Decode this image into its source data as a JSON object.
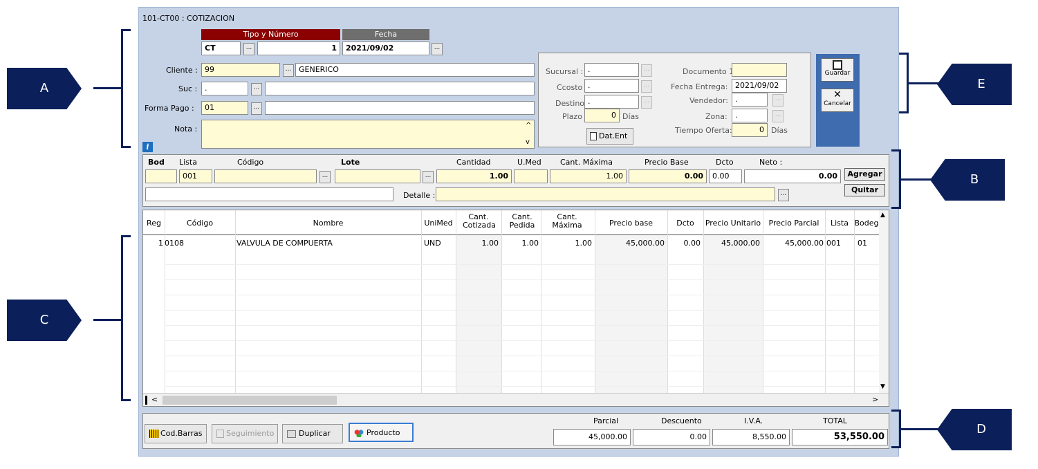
{
  "window": {
    "title": "101-CT00 : COTIZACION"
  },
  "header": {
    "tipo_label": "Tipo y Número",
    "fecha_label": "Fecha",
    "tipo": "CT",
    "numero": "1",
    "fecha": "2021/09/02"
  },
  "client": {
    "cliente_label": "Cliente :",
    "cliente_code": "99",
    "cliente_name": "GENERICO",
    "suc_label": "Suc :",
    "suc_value": ".",
    "forma_label": "Forma Pago :",
    "forma_value": "01",
    "nota_label": "Nota :"
  },
  "extra": {
    "sucursal_label": "Sucursal :",
    "sucursal": ".",
    "ccosto_label": "Ccosto :",
    "ccosto": ".",
    "destino_label": "Destino :",
    "destino": ".",
    "plazo_label": "Plazo :",
    "plazo": "0",
    "dias": "Días",
    "doc1_label": "Documento 1:",
    "doc1": "",
    "fecha_ent_label": "Fecha Entrega:",
    "fecha_ent": "2021/09/02",
    "vendedor_label": "Vendedor:",
    "vendedor": ".",
    "zona_label": "Zona:",
    "zona": ".",
    "tiempo_label": "Tiempo Oferta:",
    "tiempo": "0",
    "dias2": "Días",
    "datent": "Dat.Ent"
  },
  "actions": {
    "guardar": "Guardar",
    "cancelar": "Cancelar"
  },
  "entry": {
    "bod": "Bod",
    "lista": "Lista",
    "codigo": "Código",
    "lote": "Lote",
    "cantidad": "Cantidad",
    "umed": "U.Med",
    "cant_max": "Cant. Máxima",
    "precio_base": "Precio Base",
    "dcto": "Dcto",
    "neto": "Neto :",
    "lista_val": "001",
    "cantidad_val": "1.00",
    "cant_max_val": "1.00",
    "precio_base_val": "0.00",
    "dcto_val": "0.00",
    "neto_val": "0.00",
    "detalle": "Detalle :",
    "agregar": "Agregar",
    "quitar": "Quitar"
  },
  "grid": {
    "headers": [
      "Reg",
      "Código",
      "Nombre",
      "UniMed",
      "Cant. Cotizada",
      "Cant. Pedida",
      "Cant. Máxima",
      "Precio base",
      "Dcto",
      "Precio Unitario",
      "Precio Parcial",
      "Lista",
      "Bodeg"
    ],
    "row": [
      "1",
      "0108",
      "VALVULA DE COMPUERTA",
      "UND",
      "1.00",
      "1.00",
      "1.00",
      "45,000.00",
      "0.00",
      "45,000.00",
      "45,000.00",
      "001",
      "01"
    ]
  },
  "footer": {
    "codbarras": "Cod.Barras",
    "seguimiento": "Seguimiento",
    "duplicar": "Duplicar",
    "producto": "Producto",
    "parcial_label": "Parcial",
    "descuento_label": "Descuento",
    "iva_label": "I.V.A.",
    "total_label": "TOTAL",
    "parcial": "45,000.00",
    "descuento": "0.00",
    "iva": "8,550.00",
    "total": "53,550.00"
  },
  "markers": {
    "a": "A",
    "b": "B",
    "c": "C",
    "d": "D",
    "e": "E"
  },
  "colors": {
    "window_bg": "#c6d3e6",
    "marker": "#0b1f5a",
    "tipo_hdr": "#8b0000",
    "fecha_hdr": "#6e6e6e",
    "yellow_field": "#fffbd4",
    "action_panel": "#3f6cae"
  }
}
